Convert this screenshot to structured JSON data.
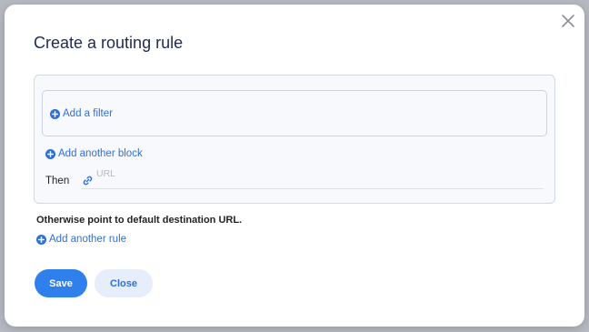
{
  "dialog": {
    "title": "Create a routing rule",
    "close_icon": "close-icon"
  },
  "rule": {
    "add_filter_label": "Add a filter",
    "add_block_label": "Add another block",
    "then_label": "Then",
    "url_placeholder": "URL",
    "url_value": ""
  },
  "otherwise_text": "Otherwise point to default destination URL.",
  "add_rule_label": "Add another rule",
  "actions": {
    "save_label": "Save",
    "close_label": "Close"
  },
  "colors": {
    "accent": "#2f80ed",
    "link": "#2f6fd8",
    "title": "#1f2a55",
    "secondary_button_bg": "#e6eefb"
  },
  "icons": {
    "plus": "plus-circle-icon",
    "link": "link-icon",
    "close": "close-icon"
  }
}
